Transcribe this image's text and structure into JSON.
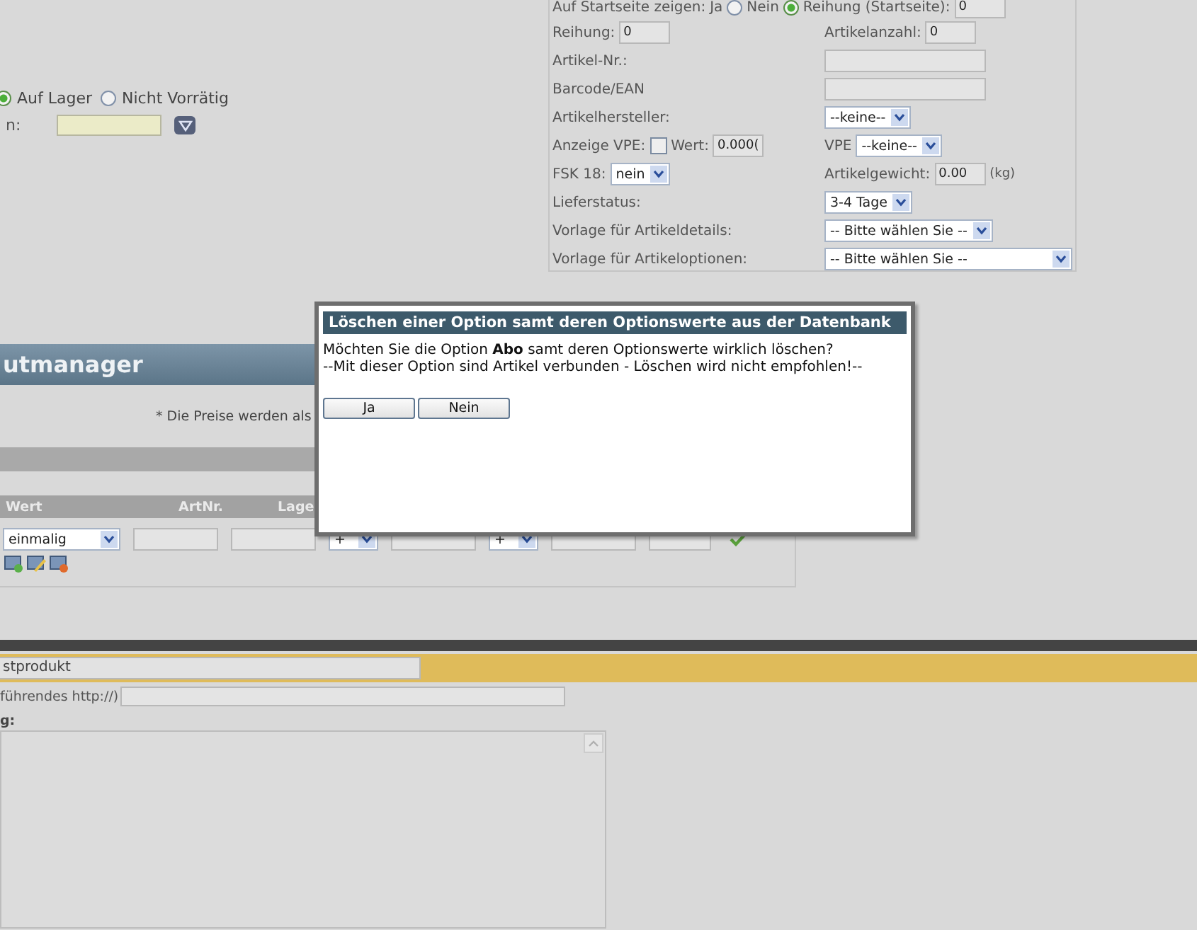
{
  "availability": {
    "options": [
      {
        "label": "Auf Lager",
        "selected": true
      },
      {
        "label": "Nicht Vorrätig",
        "selected": false
      }
    ]
  },
  "date_row": {
    "label": "n:"
  },
  "startpage_row": {
    "label": "Auf Startseite zeigen:",
    "options": [
      {
        "label": "Ja",
        "selected": false
      },
      {
        "label": "Nein",
        "selected": true
      }
    ],
    "order_label": "Reihung (Startseite):",
    "order_value": "0"
  },
  "article_rows": [
    {
      "left": [
        {
          "kind": "label",
          "text": "Reihung:"
        },
        {
          "kind": "input",
          "value": "0"
        }
      ],
      "right": [
        {
          "kind": "label",
          "text": "Artikelanzahl:"
        },
        {
          "kind": "input",
          "value": "0"
        }
      ]
    },
    {
      "left": [
        {
          "kind": "label",
          "text": "Artikel-Nr.:"
        }
      ],
      "right": [
        {
          "kind": "input"
        }
      ]
    },
    {
      "left": [
        {
          "kind": "label",
          "text": "Barcode/EAN"
        }
      ],
      "right": [
        {
          "kind": "input"
        }
      ]
    },
    {
      "left": [
        {
          "kind": "label",
          "text": "Artikelhersteller:"
        }
      ],
      "right": [
        {
          "kind": "select",
          "value": "--keine--"
        }
      ]
    },
    {
      "left": [
        {
          "kind": "label",
          "text": "Anzeige VPE:"
        },
        {
          "kind": "checkbox",
          "checked": false
        },
        {
          "kind": "label",
          "text": "Wert:"
        },
        {
          "kind": "input",
          "value": "0.000("
        }
      ],
      "right": [
        {
          "kind": "label",
          "text": "VPE"
        },
        {
          "kind": "select",
          "value": "--keine--"
        }
      ]
    },
    {
      "left": [
        {
          "kind": "label",
          "text": "FSK 18:"
        },
        {
          "kind": "select",
          "value": "nein"
        }
      ],
      "right": [
        {
          "kind": "label",
          "text": "Artikelgewicht:"
        },
        {
          "kind": "input",
          "value": "0.00"
        },
        {
          "kind": "unit",
          "text": "(kg)"
        }
      ]
    },
    {
      "left": [
        {
          "kind": "label",
          "text": "Lieferstatus:"
        }
      ],
      "right": [
        {
          "kind": "select",
          "value": "3-4 Tage"
        }
      ]
    },
    {
      "left": [
        {
          "kind": "label",
          "text": "Vorlage für Artikeldetails:"
        }
      ],
      "right": [
        {
          "kind": "select",
          "value": "-- Bitte wählen Sie --"
        }
      ]
    },
    {
      "left": [
        {
          "kind": "label",
          "text": "Vorlage für Artikeloptionen:"
        }
      ],
      "right": [
        {
          "kind": "select",
          "value": "-- Bitte wählen Sie --"
        }
      ]
    }
  ],
  "manager": {
    "title": "utmanager",
    "price_note": "* Die Preise werden als",
    "columns": [
      "Wert",
      "ArtNr.",
      "Lage"
    ],
    "row": {
      "value_select": "einmalig",
      "prefix_selects": [
        "+",
        "+"
      ]
    }
  },
  "product": {
    "name_value": "stprodukt",
    "url_label": "führendes http://)",
    "description_label": "g:"
  },
  "dialog": {
    "title": "Löschen einer Option samt deren Optionswerte aus der Datenbank",
    "message": "Möchten Sie die Option **Abo** samt deren Optionswerte wirklich löschen?",
    "warning": "--Mit dieser Option sind Artikel verbunden - Löschen wird nicht empfohlen!--",
    "buttons": [
      "Ja",
      "Nein"
    ]
  }
}
